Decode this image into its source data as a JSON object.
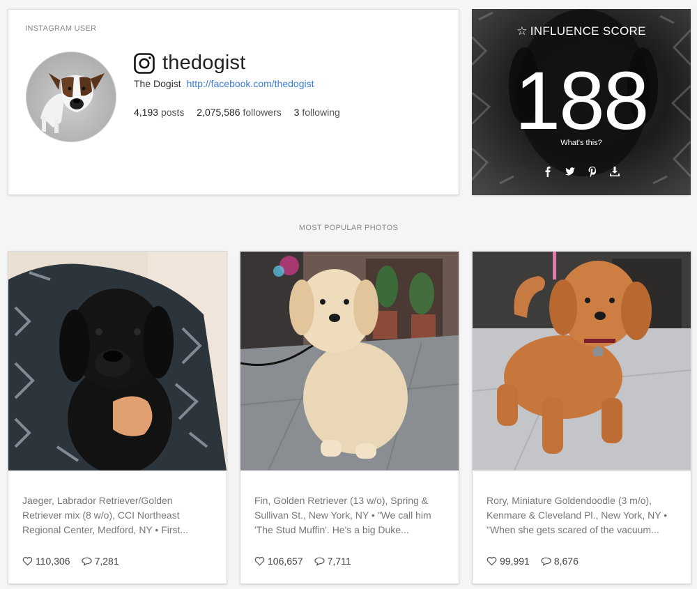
{
  "profile": {
    "section_label": "INSTAGRAM USER",
    "username": "thedogist",
    "display_name": "The Dogist",
    "link": "http://facebook.com/thedogist",
    "posts_count": "4,193",
    "posts_label": "posts",
    "followers_count": "2,075,586",
    "followers_label": "followers",
    "following_count": "3",
    "following_label": "following"
  },
  "score": {
    "title": "INFLUENCE SCORE",
    "value": "188",
    "whats_this": "What's this?",
    "share_icons": [
      "facebook-icon",
      "twitter-icon",
      "pinterest-icon",
      "download-icon"
    ]
  },
  "popular": {
    "label": "MOST POPULAR PHOTOS",
    "photos": [
      {
        "caption": "Jaeger, Labrador Retriever/Golden Retriever mix (8 w/o), CCI Northeast Regional Center, Medford, NY • First...",
        "likes": "110,306",
        "comments": "7,281"
      },
      {
        "caption": "Fin, Golden Retriever (13 w/o), Spring & Sullivan St., New York, NY • \"We call him 'The Stud Muffin'. He's a big Duke...",
        "likes": "106,657",
        "comments": "7,711"
      },
      {
        "caption": "Rory, Miniature Goldendoodle (3 m/o), Kenmare & Cleveland Pl., New York, NY • \"When she gets scared of the vacuum...",
        "likes": "99,991",
        "comments": "8,676"
      }
    ]
  },
  "colors": {
    "link": "#3b7dd8",
    "page_bg": "#f5f5f5",
    "muted_text": "#888888"
  }
}
